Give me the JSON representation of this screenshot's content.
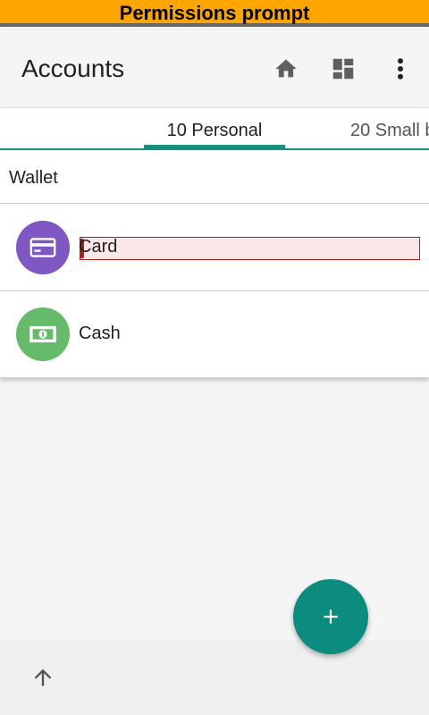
{
  "banner": {
    "text": "Permissions prompt"
  },
  "appbar": {
    "title": "Accounts",
    "icons": [
      "home-icon",
      "dashboard-icon",
      "more-vert-icon"
    ]
  },
  "tabs": [
    {
      "label": "10 Personal",
      "active": true
    },
    {
      "label": "20 Small b",
      "active": false
    }
  ],
  "section": {
    "title": "Wallet"
  },
  "accounts": [
    {
      "label": "Card",
      "icon": "credit-card-icon",
      "color": "#7e57c2"
    },
    {
      "label": "Cash",
      "icon": "cash-icon",
      "color": "#66bb6a"
    }
  ],
  "fab": {
    "icon": "add-icon",
    "color": "#0b8c7e"
  },
  "bottom": {
    "icon": "arrow-up-icon"
  },
  "colors": {
    "accent": "#16907f",
    "banner": "#ffa500"
  }
}
